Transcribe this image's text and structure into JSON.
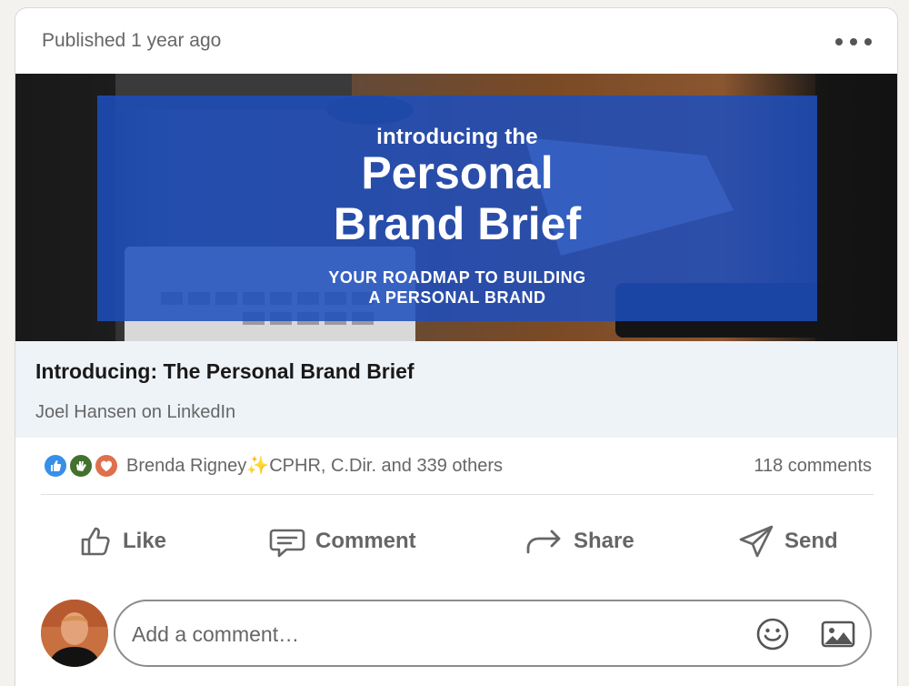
{
  "post": {
    "published": "Published 1 year ago",
    "more_icon": "ellipsis-icon"
  },
  "banner": {
    "kicker": "introducing the",
    "title_line1": "Personal",
    "title_line2": "Brand Brief",
    "subtitle_line1": "YOUR ROADMAP TO BUILDING",
    "subtitle_line2": "A PERSONAL BRAND",
    "box_color": "#1d4ebe"
  },
  "article": {
    "title": "Introducing: The Personal Brand Brief",
    "source": "Joel Hansen on LinkedIn"
  },
  "social": {
    "reactions": [
      "like-reaction-icon",
      "celebrate-reaction-icon",
      "love-reaction-icon"
    ],
    "reactor_name": "Brenda Rigney",
    "sparkle": "✨",
    "reactor_rest": "CPHR, C.Dir. and 339 others",
    "comments": "118 comments"
  },
  "actions": {
    "like": "Like",
    "comment": "Comment",
    "share": "Share",
    "send": "Send"
  },
  "composer": {
    "placeholder": "Add a comment…",
    "emoji_icon": "smiley-icon",
    "image_icon": "image-icon"
  },
  "colors": {
    "accent": "#378fe9",
    "muted_text": "#666666",
    "article_bg": "#eef3f8"
  }
}
